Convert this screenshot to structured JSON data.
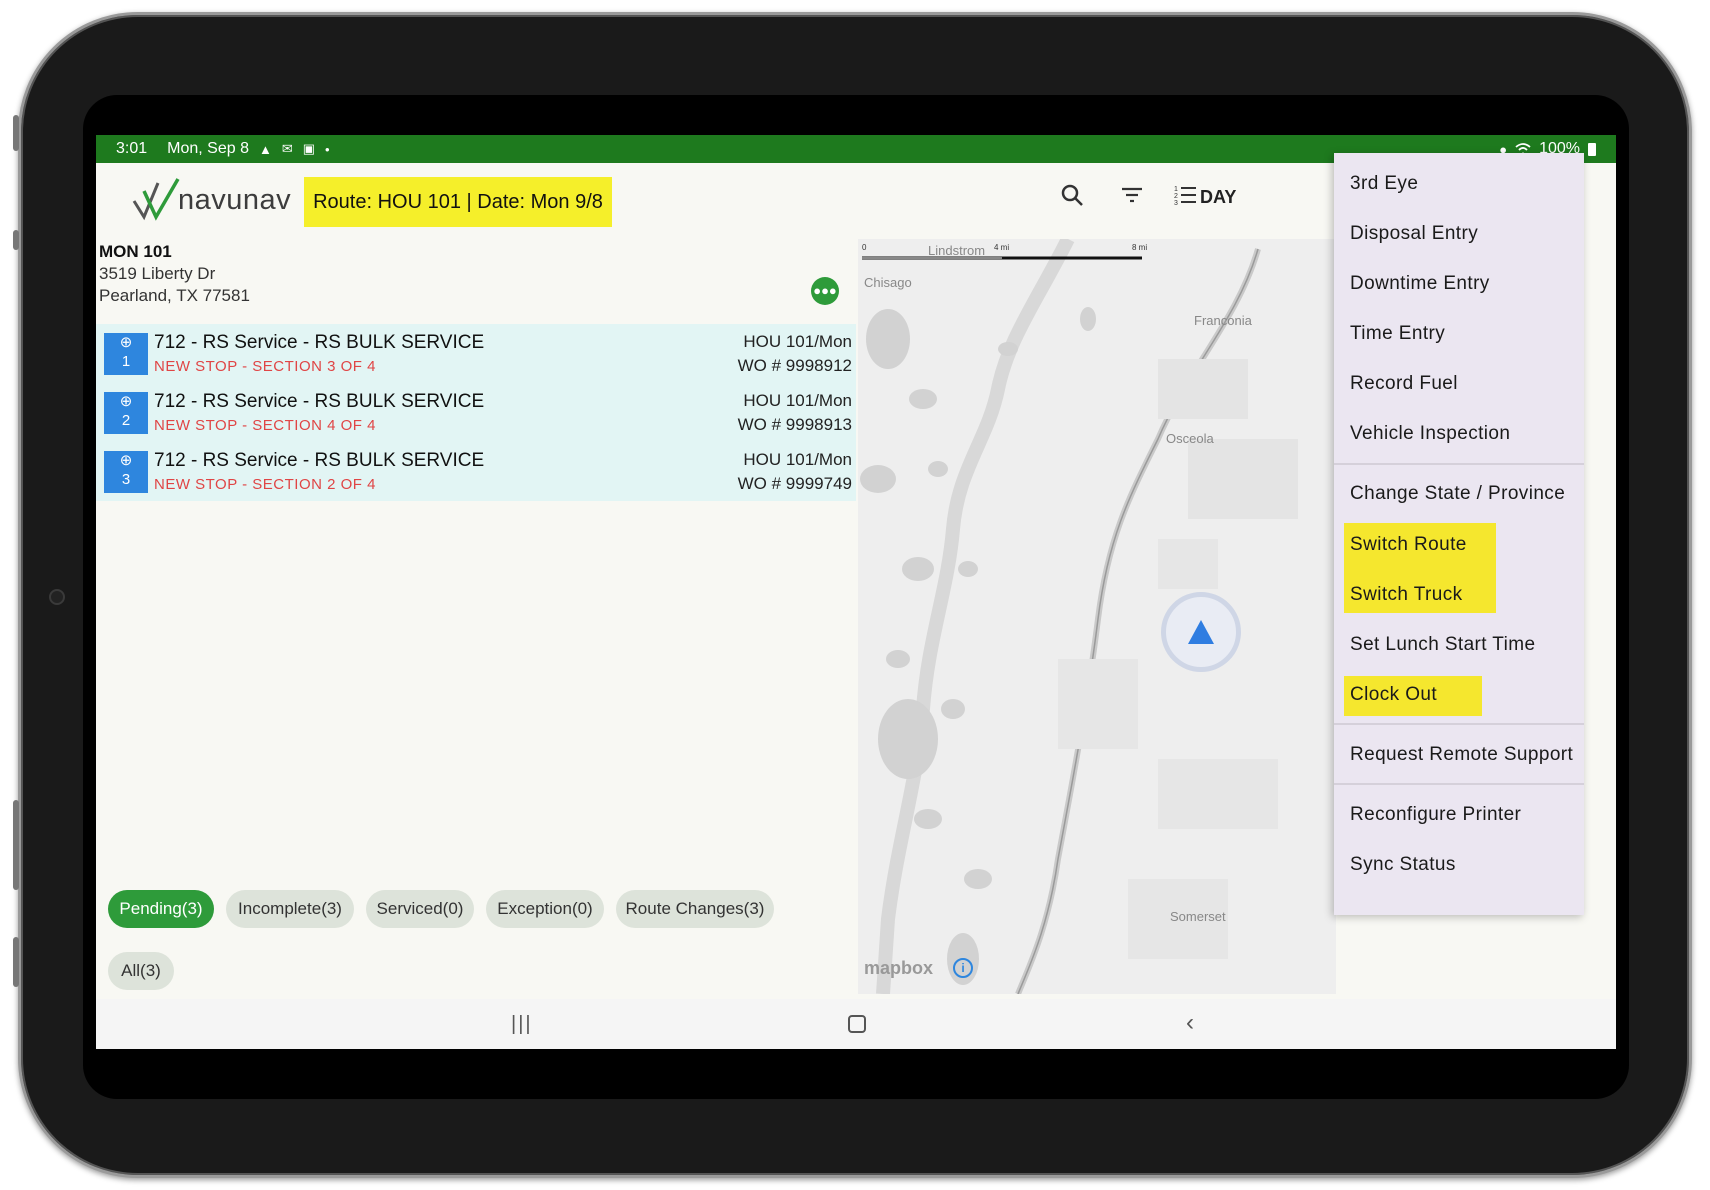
{
  "status_bar": {
    "time": "3:01",
    "date": "Mon, Sep 8",
    "battery": "100%"
  },
  "app": {
    "logo_text": "navunav",
    "route_badge": "Route: HOU 101 | Date: Mon 9/8",
    "day_label": "DAY"
  },
  "customer": {
    "name": "MON 101",
    "address1": "3519 Liberty Dr",
    "address2": "Pearland, TX 77581"
  },
  "stops": [
    {
      "num": "1",
      "title": "712 - RS Service - RS BULK SERVICE",
      "subtitle": "NEW STOP - SECTION 3 OF 4",
      "route": "HOU 101/Mon",
      "wo": "WO # 9998912"
    },
    {
      "num": "2",
      "title": "712 - RS Service - RS BULK SERVICE",
      "subtitle": "NEW STOP - SECTION 4 OF 4",
      "route": "HOU 101/Mon",
      "wo": "WO # 9998913"
    },
    {
      "num": "3",
      "title": "712 - RS Service - RS BULK SERVICE",
      "subtitle": "NEW STOP - SECTION 2 OF 4",
      "route": "HOU 101/Mon",
      "wo": "WO # 9999749"
    }
  ],
  "chips": {
    "pending": "Pending(3)",
    "incomplete": "Incomplete(3)",
    "serviced": "Serviced(0)",
    "exception": "Exception(0)",
    "route_changes": "Route Changes(3)",
    "all": "All(3)"
  },
  "map": {
    "labels": {
      "lindstrom": "Lindstrom",
      "chisago": "Chisago",
      "franconia": "Franconia",
      "osceola": "Osceola",
      "somerset": "Somerset"
    },
    "scale": {
      "zero": "0",
      "mid": "4 mi",
      "end": "8 mi"
    },
    "attribution": "mapbox",
    "info": "i"
  },
  "menu": {
    "items": [
      "3rd Eye",
      "Disposal Entry",
      "Downtime Entry",
      "Time Entry",
      "Record Fuel",
      "Vehicle Inspection",
      "Change State / Province",
      "Switch Route",
      "Switch Truck",
      "Set Lunch Start Time",
      "Clock Out",
      "Request Remote Support",
      "Reconfigure Printer",
      "Sync Status"
    ],
    "highlighted": [
      "Switch Route",
      "Switch Truck",
      "Clock Out"
    ]
  },
  "colors": {
    "status_bar": "#1e7a1e",
    "highlight": "#f5ef2a",
    "stop_bg": "#e2f5f4",
    "stop_badge": "#2e86de",
    "active_chip": "#2e9b3a",
    "menu_bg": "#ebe6f1"
  },
  "icons": {
    "search": "search-icon",
    "filter": "filter-icon",
    "list": "list-icon"
  }
}
